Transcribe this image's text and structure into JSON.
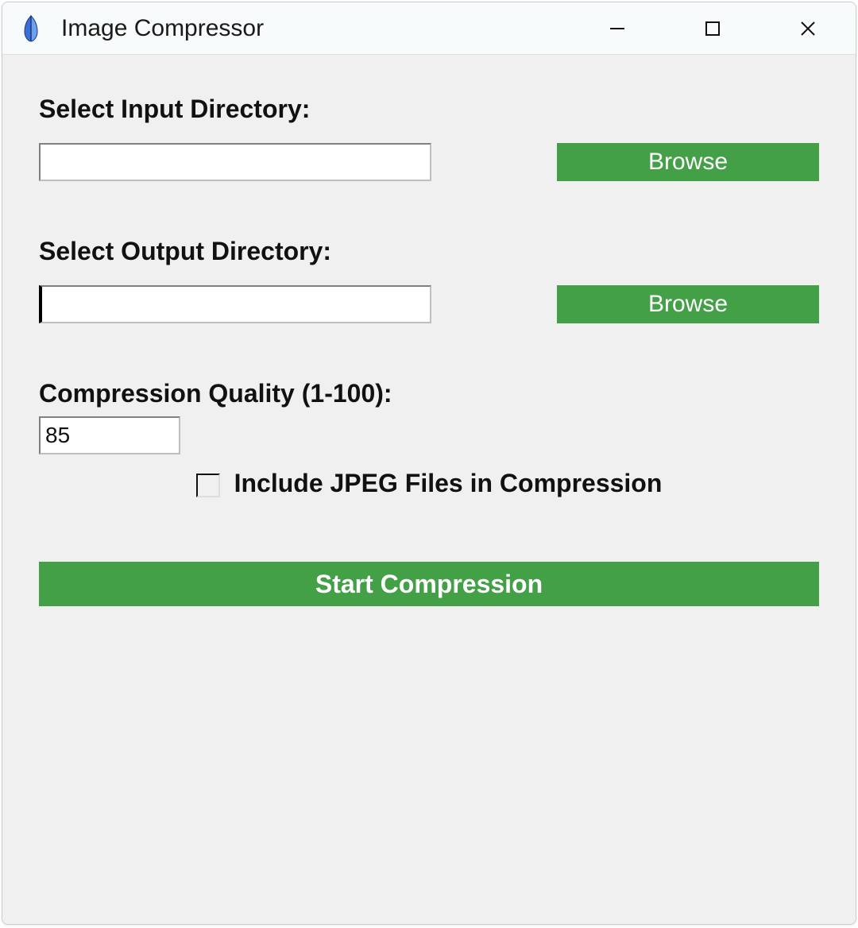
{
  "window": {
    "title": "Image Compressor",
    "icon": "feather-icon"
  },
  "labels": {
    "input_dir": "Select Input Directory:",
    "output_dir": "Select Output Directory:",
    "quality": "Compression Quality (1-100):"
  },
  "inputs": {
    "input_dir_value": "",
    "output_dir_value": "",
    "quality_value": "85"
  },
  "buttons": {
    "browse_input": "Browse",
    "browse_output": "Browse",
    "start": "Start Compression"
  },
  "checkbox": {
    "include_jpeg_label": "Include JPEG Files in Compression",
    "include_jpeg_checked": false
  },
  "colors": {
    "accent_green": "#43a047",
    "client_bg": "#f0f0f0",
    "titlebar_bg": "#f7fbfb"
  }
}
